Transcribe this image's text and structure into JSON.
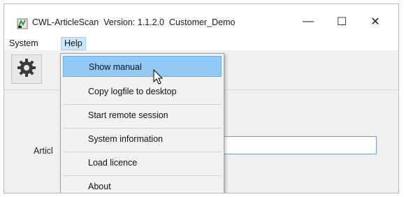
{
  "window": {
    "title": "CWL-ArticleScan  Version: 1.1.2.0  Customer_Demo",
    "minimize_glyph": "—",
    "maximize_glyph": "☐",
    "close_glyph": "✕"
  },
  "menubar": {
    "items": [
      {
        "label": "System"
      },
      {
        "label": "Help"
      }
    ]
  },
  "toolbar": {
    "settings_icon": "gear-icon"
  },
  "main": {
    "article_label": "Articl",
    "article_value": ""
  },
  "help_menu": {
    "items": [
      {
        "label": "Show manual",
        "highlighted": true
      },
      {
        "label": "Copy logfile to desktop"
      },
      {
        "label": "Start remote session"
      },
      {
        "label": "System information"
      },
      {
        "label": "Load licence"
      },
      {
        "label": "About"
      }
    ]
  },
  "colors": {
    "highlight": "#91c9f7",
    "menu_active": "#cce8ff",
    "window_bg": "#f0f0f0"
  }
}
